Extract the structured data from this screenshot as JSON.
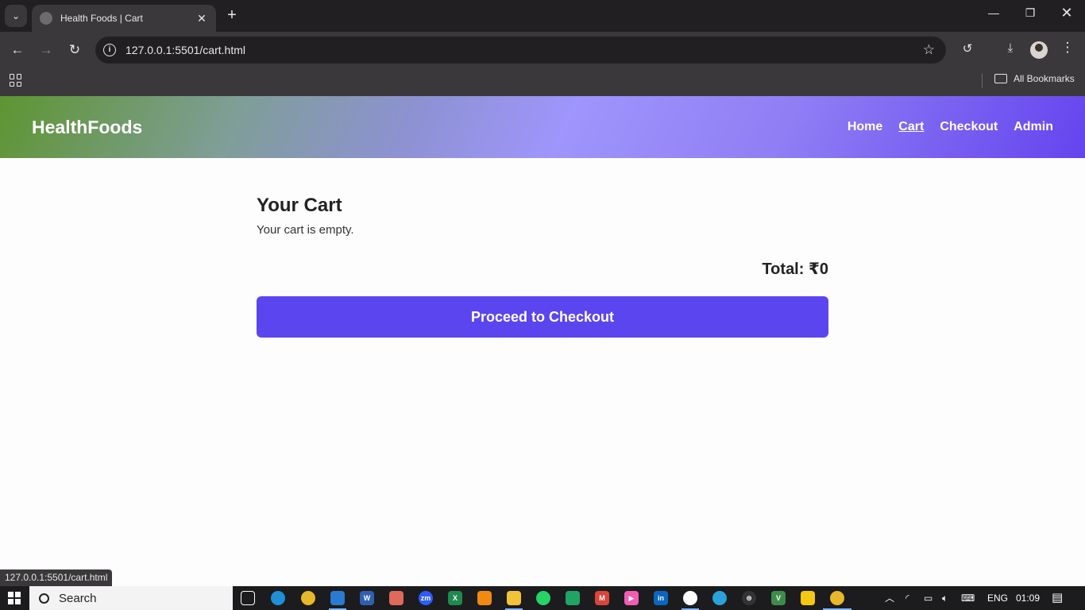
{
  "browser": {
    "tab_title": "Health Foods | Cart",
    "url": "127.0.0.1:5501/cart.html",
    "bookmarks_label": "All Bookmarks",
    "status_url": "127.0.0.1:5501/cart.html"
  },
  "site": {
    "brand": "HealthFoods",
    "nav": [
      {
        "label": "Home",
        "active": false
      },
      {
        "label": "Cart",
        "active": true
      },
      {
        "label": "Checkout",
        "active": false
      },
      {
        "label": "Admin",
        "active": false
      }
    ],
    "header_gradient": [
      "#5e9531",
      "#9f95fc",
      "#6444ee"
    ]
  },
  "cart": {
    "heading": "Your Cart",
    "empty_message": "Your cart is empty.",
    "total_label": "Total: ₹0",
    "checkout_label": "Proceed to Checkout",
    "button_color": "#5b45ef"
  },
  "taskbar": {
    "search_label": "Search",
    "apps": [
      "task-view",
      "edge",
      "chrome",
      "vscode",
      "word",
      "photos",
      "zoom",
      "excel",
      "vlc",
      "file-explorer",
      "whatsapp",
      "meet",
      "gmail",
      "youtube",
      "linkedin",
      "github",
      "telegram",
      "openai",
      "app-v",
      "power-bi",
      "chrome-active"
    ],
    "language": "ENG",
    "time": "01:09"
  }
}
